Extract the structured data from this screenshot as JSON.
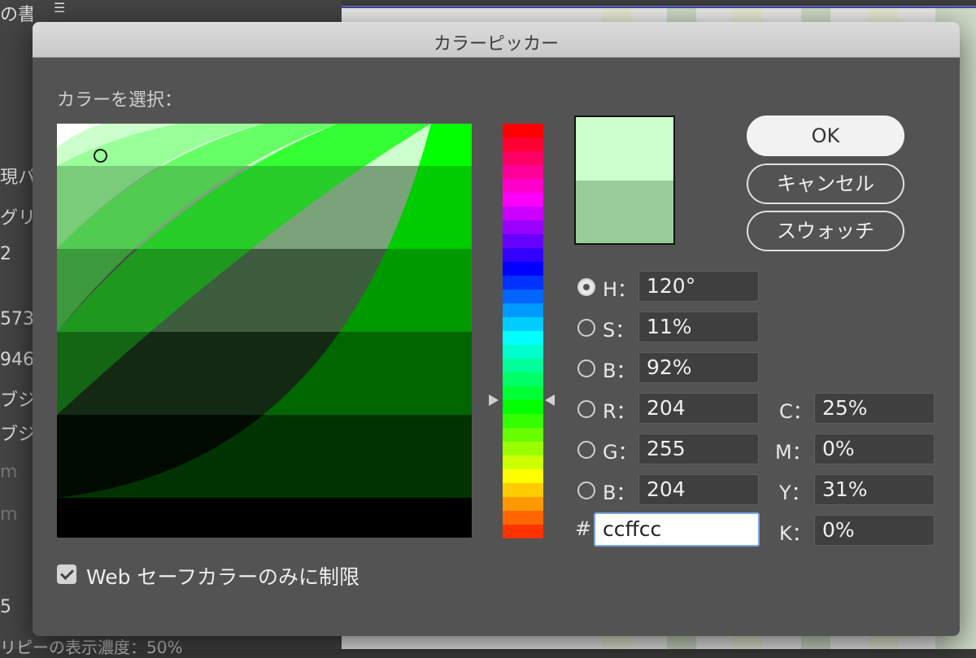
{
  "dialog": {
    "title": "カラーピッカー",
    "select_color_label": "カラーを選択：",
    "buttons": {
      "ok": "OK",
      "cancel": "キャンセル",
      "swatches": "スウォッチ"
    },
    "preview": {
      "new_color": "#ccffcc",
      "old_color": "#99cc99"
    },
    "hsb": [
      {
        "key": "H",
        "label": "H：",
        "value": "120°",
        "selected": true
      },
      {
        "key": "S",
        "label": "S：",
        "value": "11%",
        "selected": false
      },
      {
        "key": "B",
        "label": "B：",
        "value": "92%",
        "selected": false
      }
    ],
    "rgb": [
      {
        "key": "R",
        "label": "R：",
        "value": "204",
        "selected": false
      },
      {
        "key": "G",
        "label": "G：",
        "value": "255",
        "selected": false
      },
      {
        "key": "B",
        "label": "B：",
        "value": "204",
        "selected": false
      }
    ],
    "cmyk": [
      {
        "key": "C",
        "label": "C：",
        "value": "25%"
      },
      {
        "key": "M",
        "label": "M：",
        "value": "0%"
      },
      {
        "key": "Y",
        "label": "Y：",
        "value": "31%"
      },
      {
        "key": "K",
        "label": "K：",
        "value": "0%"
      }
    ],
    "hex": {
      "label": "#",
      "value": "ccffcc"
    },
    "web_safe": {
      "label": "Web セーフカラーのみに制限",
      "checked": true
    }
  },
  "background_app": {
    "fragments": [
      "の書",
      "現パク",
      "グリ",
      "2",
      "573",
      "946",
      "ブジ",
      "ブジ",
      "m",
      "m",
      "5"
    ],
    "bottom_text": "リピーの表示濃度：50%"
  }
}
